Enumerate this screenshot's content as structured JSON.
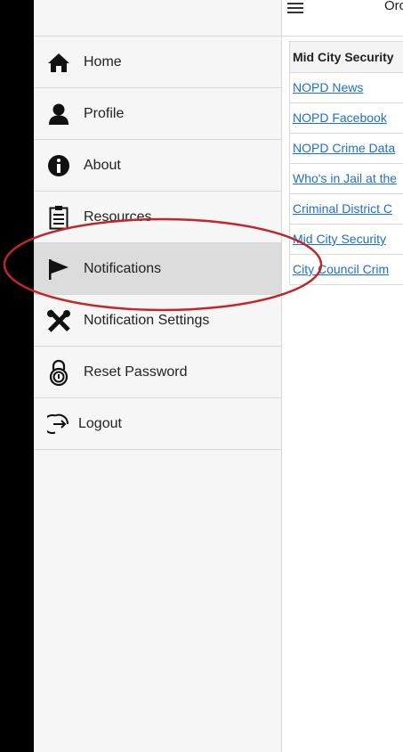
{
  "topbar": {
    "title": "Orc"
  },
  "menu": [
    {
      "id": "home",
      "label": "Home",
      "icon": "home-icon"
    },
    {
      "id": "profile",
      "label": "Profile",
      "icon": "person-icon"
    },
    {
      "id": "about",
      "label": "About",
      "icon": "info-icon"
    },
    {
      "id": "resources",
      "label": "Resources",
      "icon": "clipboard-icon"
    },
    {
      "id": "notifications",
      "label": "Notifications",
      "icon": "flag-icon",
      "active": true
    },
    {
      "id": "notification-settings",
      "label": "Notification Settings",
      "icon": "tools-icon"
    },
    {
      "id": "reset-password",
      "label": "Reset Password",
      "icon": "lock-icon"
    },
    {
      "id": "logout",
      "label": "Logout",
      "icon": "logout-icon"
    }
  ],
  "list": {
    "header": "Mid City Security",
    "links": [
      "NOPD News",
      "NOPD Facebook",
      "NOPD Crime Data",
      "Who's in Jail at the",
      "Criminal District C",
      "Mid City Security",
      "City Council Crim"
    ]
  },
  "colors": {
    "link": "#1e6fcf",
    "annotation": "#c0262a",
    "active_bg": "#dcdcdc"
  }
}
